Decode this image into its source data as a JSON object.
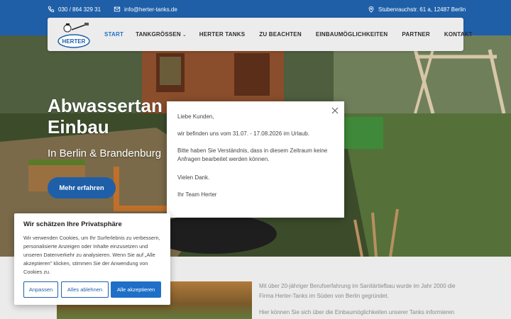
{
  "topbar": {
    "phone": "030 / 864 329 31",
    "email": "info@herter-tanks.de",
    "address": "Stubenrauchstr. 61 a, 12487 Berlin"
  },
  "logo": {
    "text": "HERTER"
  },
  "nav": {
    "items": [
      {
        "label": "START",
        "active": true
      },
      {
        "label": "TANKGRÖSSEN",
        "dropdown": true
      },
      {
        "label": "HERTER TANKS"
      },
      {
        "label": "ZU BEACHTEN"
      },
      {
        "label": "EINBAUMÖGLICHKEITEN"
      },
      {
        "label": "PARTNER"
      },
      {
        "label": "KONTAKT"
      }
    ]
  },
  "hero": {
    "title_line1": "Abwassertan",
    "title_line2": "Einbau",
    "subtitle": "In Berlin & Brandenburg",
    "cta": "Mehr erfahren"
  },
  "modal": {
    "greeting": "Liebe Kunden,",
    "line1": "wir befinden uns vom 31.07. - 17.08.2026 im Urlaub.",
    "line2": "Bitte haben Sie Verständnis, dass in diesem Zeitraum keine Anfragen bearbeitet werden können.",
    "thanks": "Vielen Dank.",
    "signature": "Ihr Team Herter"
  },
  "intro": {
    "p1": "Mit über 20-jähriger Berufserfahrung im Sanitärtiefbau wurde im Jahr 2000 die Firma Herter-Tanks im Süden von Berlin gegründet.",
    "p2": "Hier können Sie sich über die Einbaumöglichkeiten unserer Tanks informieren"
  },
  "cookie": {
    "title": "Wir schätzen Ihre Privatsphäre",
    "body": "Wir verwenden Cookies, um Ihr Surferlebnis zu verbessern, personalisierte Anzeigen oder Inhalte einzusetzen und unseren Datenverkehr zu analysieren. Wenn Sie auf „Alle akzeptieren\" klicken, stimmen Sie der Anwendung von Cookies zu.",
    "customize": "Anpassen",
    "reject": "Alles ablehnen",
    "accept": "Alle akzeptieren"
  },
  "colors": {
    "brand": "#1f5fa8",
    "accent": "#1f6fc8"
  }
}
